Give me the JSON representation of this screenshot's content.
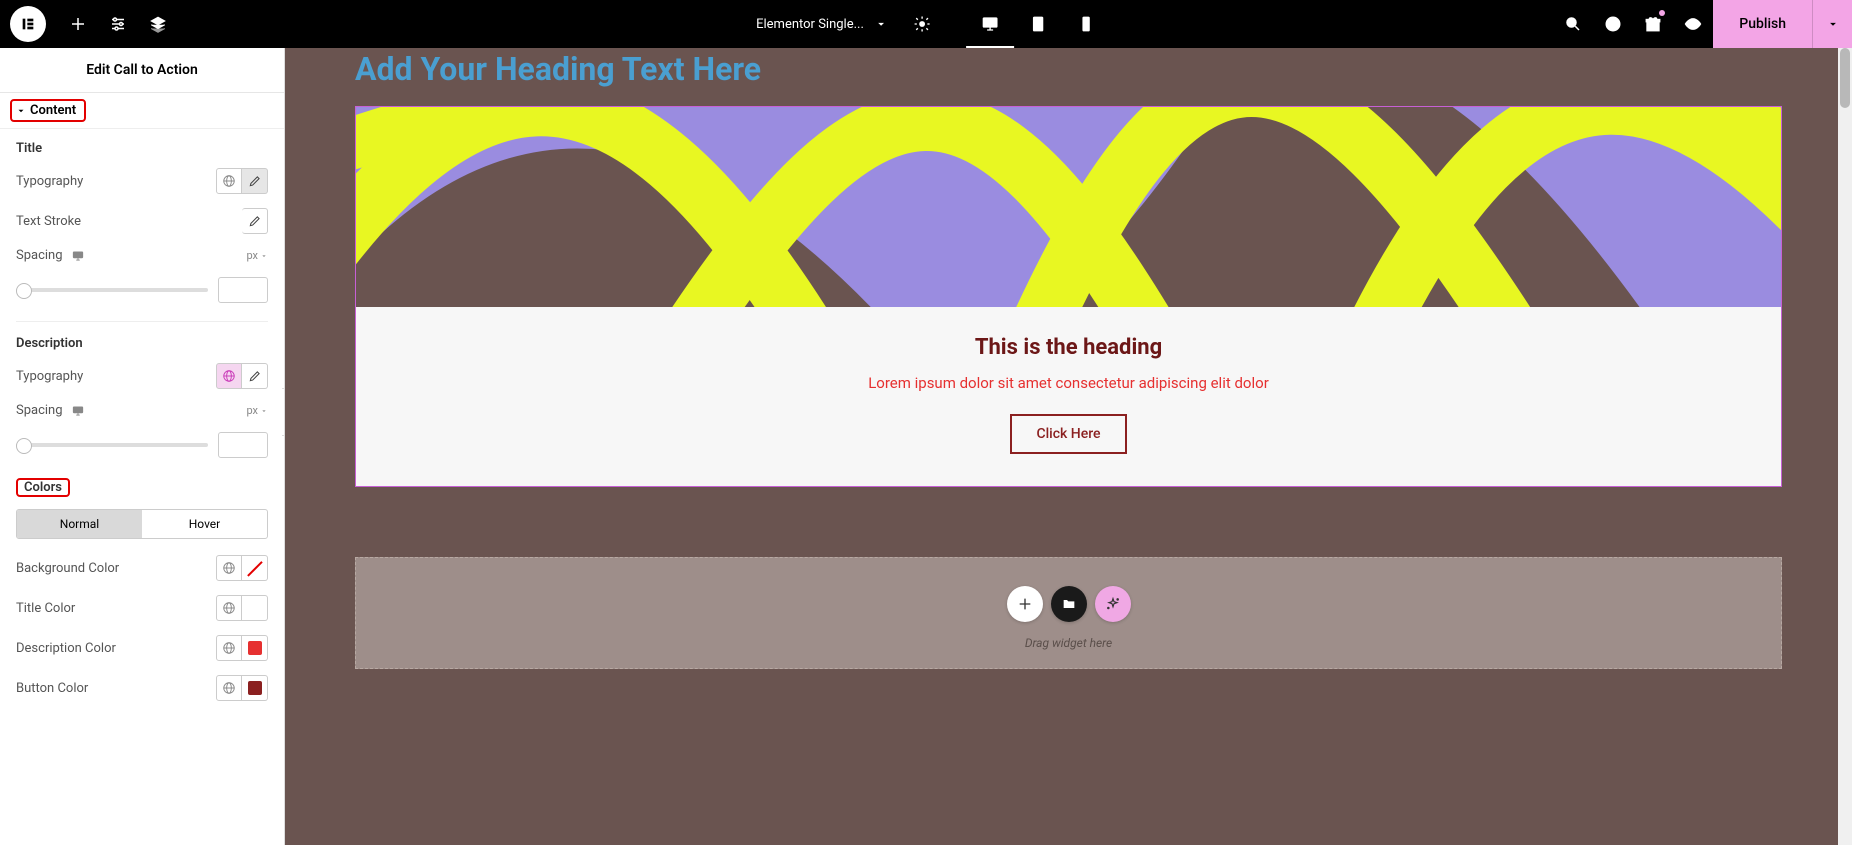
{
  "topbar": {
    "doc_title": "Elementor Single...",
    "publish_label": "Publish"
  },
  "panel": {
    "title": "Edit Call to Action",
    "sections": {
      "content": {
        "label": "Content",
        "title_group": "Title",
        "typography_label": "Typography",
        "text_stroke_label": "Text Stroke",
        "spacing_label": "Spacing",
        "spacing_unit": "px",
        "description_group": "Description"
      },
      "colors": {
        "label": "Colors",
        "tab_normal": "Normal",
        "tab_hover": "Hover",
        "bg_color_label": "Background Color",
        "title_color_label": "Title Color",
        "desc_color_label": "Description Color",
        "button_color_label": "Button Color",
        "title_color": "#6c1717",
        "desc_color": "#e63030",
        "button_color": "#8b2020"
      }
    }
  },
  "canvas": {
    "top_heading": "Add Your Heading Text Here",
    "cta": {
      "title": "This is the heading",
      "desc": "Lorem ipsum dolor sit amet consectetur adipiscing elit dolor",
      "button": "Click Here"
    },
    "dropzone_text": "Drag widget here"
  }
}
